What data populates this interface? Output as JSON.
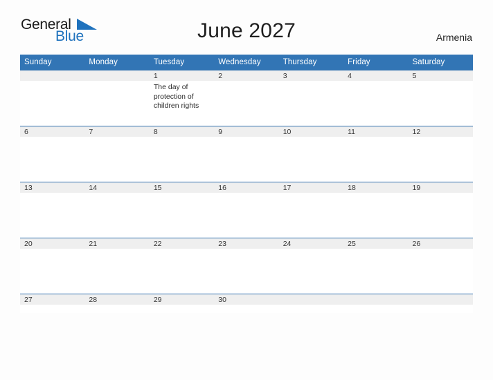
{
  "brand": {
    "name_part1": "General",
    "name_part2": "Blue",
    "flag_icon": "triangle-flag-icon",
    "accent_color": "#1f72bd"
  },
  "header": {
    "title": "June 2027",
    "region": "Armenia"
  },
  "theme": {
    "header_blue": "#3275b5",
    "day_band_gray": "#efefef",
    "row_divider_blue": "#2f6fae",
    "page_background": "#fdfdfd",
    "text_color": "#1f1f1f"
  },
  "calendar": {
    "month": "June",
    "year": "2027",
    "weekday_headers": [
      "Sunday",
      "Monday",
      "Tuesday",
      "Wednesday",
      "Thursday",
      "Friday",
      "Saturday"
    ],
    "weeks": [
      [
        {
          "date": "",
          "event": ""
        },
        {
          "date": "",
          "event": ""
        },
        {
          "date": "1",
          "event": "The day of protection of children rights"
        },
        {
          "date": "2",
          "event": ""
        },
        {
          "date": "3",
          "event": ""
        },
        {
          "date": "4",
          "event": ""
        },
        {
          "date": "5",
          "event": ""
        }
      ],
      [
        {
          "date": "6",
          "event": ""
        },
        {
          "date": "7",
          "event": ""
        },
        {
          "date": "8",
          "event": ""
        },
        {
          "date": "9",
          "event": ""
        },
        {
          "date": "10",
          "event": ""
        },
        {
          "date": "11",
          "event": ""
        },
        {
          "date": "12",
          "event": ""
        }
      ],
      [
        {
          "date": "13",
          "event": ""
        },
        {
          "date": "14",
          "event": ""
        },
        {
          "date": "15",
          "event": ""
        },
        {
          "date": "16",
          "event": ""
        },
        {
          "date": "17",
          "event": ""
        },
        {
          "date": "18",
          "event": ""
        },
        {
          "date": "19",
          "event": ""
        }
      ],
      [
        {
          "date": "20",
          "event": ""
        },
        {
          "date": "21",
          "event": ""
        },
        {
          "date": "22",
          "event": ""
        },
        {
          "date": "23",
          "event": ""
        },
        {
          "date": "24",
          "event": ""
        },
        {
          "date": "25",
          "event": ""
        },
        {
          "date": "26",
          "event": ""
        }
      ],
      [
        {
          "date": "27",
          "event": ""
        },
        {
          "date": "28",
          "event": ""
        },
        {
          "date": "29",
          "event": ""
        },
        {
          "date": "30",
          "event": ""
        },
        {
          "date": "",
          "event": ""
        },
        {
          "date": "",
          "event": ""
        },
        {
          "date": "",
          "event": ""
        }
      ]
    ]
  }
}
